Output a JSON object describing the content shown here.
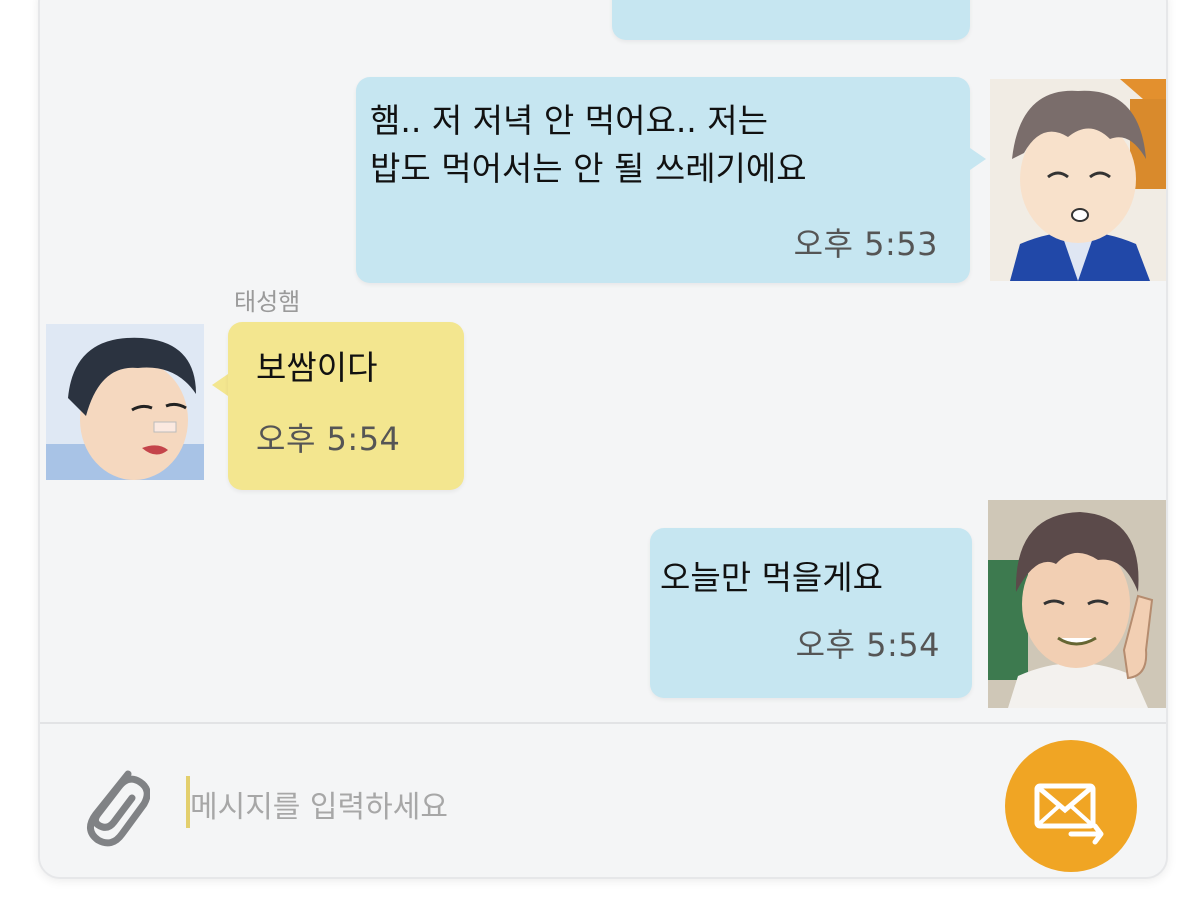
{
  "messages": [
    {
      "type": "outgoing",
      "text": "햄.. 저 저녁 안 먹어요.. 저는\n밥도 먹어서는 안 될 쓰레기에요",
      "time": "오후 5:53"
    },
    {
      "type": "incoming",
      "sender": "태성햄",
      "text": "보쌈이다",
      "time": "오후 5:54"
    },
    {
      "type": "outgoing",
      "text": "오늘만 먹을게요",
      "time": "오후 5:54"
    }
  ],
  "input": {
    "placeholder": "메시지를 입력하세요"
  },
  "icons": {
    "attach": "paperclip-icon",
    "send": "envelope-send-icon"
  },
  "colors": {
    "outgoing_bubble": "#c6e6f1",
    "incoming_bubble": "#f3e68f",
    "send_button": "#f0a524",
    "background": "#f4f5f6"
  }
}
